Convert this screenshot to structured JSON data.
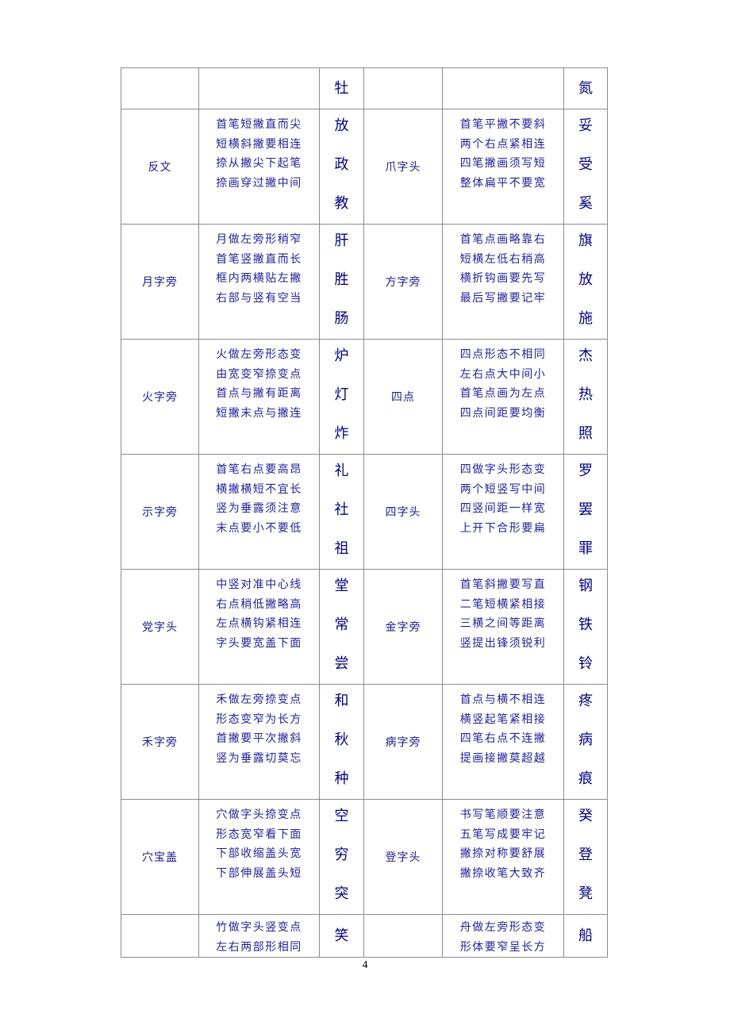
{
  "table": {
    "rows": [
      {
        "left_name": "",
        "left_rhyme": [],
        "left_chars": [
          "牡"
        ],
        "right_name": "",
        "right_rhyme": [],
        "right_chars": [
          "氮"
        ]
      },
      {
        "left_name": "反文",
        "left_rhyme": [
          "首笔短撇直而尖",
          "短横斜撇要相连",
          "捺从撇尖下起笔",
          "捺画穿过撇中间"
        ],
        "left_chars": [
          "放",
          "政",
          "教"
        ],
        "right_name": "爪字头",
        "right_rhyme": [
          "首笔平撇不要斜",
          "两个右点紧相连",
          "四笔撇画须写短",
          "整体扁平不要宽"
        ],
        "right_chars": [
          "妥",
          "受",
          "奚"
        ]
      },
      {
        "left_name": "月字旁",
        "left_rhyme": [
          "月做左旁形稍窄",
          "首笔竖撇直而长",
          "框内两横贴左撇",
          "右部与竖有空当"
        ],
        "left_chars": [
          "肝",
          "胜",
          "肠"
        ],
        "right_name": "方字旁",
        "right_rhyme": [
          "首笔点画略靠右",
          "短横左低右稍高",
          "横折钩画要先写",
          "最后写撇要记牢"
        ],
        "right_chars": [
          "旗",
          "放",
          "施"
        ]
      },
      {
        "left_name": "火字旁",
        "left_rhyme": [
          "火做左旁形态变",
          "由宽变窄捺变点",
          "首点与撇有距离",
          "短撇末点与撇连"
        ],
        "left_chars": [
          "炉",
          "灯",
          "炸"
        ],
        "right_name": "四点",
        "right_rhyme": [
          "四点形态不相同",
          "左右点大中间小",
          "首笔点画为左点",
          "四点间距要均衡"
        ],
        "right_chars": [
          "杰",
          "热",
          "照"
        ]
      },
      {
        "left_name": "示字旁",
        "left_rhyme": [
          "首笔右点要高昂",
          "横撇横短不宜长",
          "竖为垂露须注意",
          "末点要小不要低"
        ],
        "left_chars": [
          "礼",
          "社",
          "祖"
        ],
        "right_name": "四字头",
        "right_rhyme": [
          "四做字头形态变",
          "两个短竖写中间",
          "四竖间距一样宽",
          "上开下合形要扁"
        ],
        "right_chars": [
          "罗",
          "罢",
          "罪"
        ]
      },
      {
        "left_name": "党字头",
        "left_rhyme": [
          "中竖对准中心线",
          "右点稍低撇略高",
          "左点横钩紧相连",
          "字头要宽盖下面"
        ],
        "left_chars": [
          "堂",
          "常",
          "尝"
        ],
        "right_name": "金字旁",
        "right_rhyme": [
          "首笔斜撇要写直",
          "二笔短横紧相接",
          "三横之间等距离",
          "竖提出锋须锐利"
        ],
        "right_chars": [
          "钢",
          "铁",
          "铃"
        ]
      },
      {
        "left_name": "禾字旁",
        "left_rhyme": [
          "禾做左旁捺变点",
          "形态变窄为长方",
          "首撇要平次撇斜",
          "竖为垂露切莫忘"
        ],
        "left_chars": [
          "和",
          "秋",
          "种"
        ],
        "right_name": "病字旁",
        "right_rhyme": [
          "首点与横不相连",
          "横竖起笔紧相接",
          "四笔右点不连撇",
          "提画接撇莫超越"
        ],
        "right_chars": [
          "疼",
          "病",
          "痕"
        ]
      },
      {
        "left_name": "穴宝盖",
        "left_rhyme": [
          "穴做字头捺变点",
          "形态宽窄看下面",
          "下部收缩盖头宽",
          "下部伸展盖头短"
        ],
        "left_chars": [
          "空",
          "穷",
          "突"
        ],
        "right_name": "登字头",
        "right_rhyme": [
          "书写笔顺要注意",
          "五笔写成要牢记",
          "撇捺对称要舒展",
          "撇捺收笔大致齐"
        ],
        "right_chars": [
          "癸",
          "登",
          "凳"
        ]
      },
      {
        "left_name": "",
        "left_rhyme": [
          "竹做字头竖变点",
          "左右两部形相同"
        ],
        "left_chars": [
          "笑"
        ],
        "right_name": "",
        "right_rhyme": [
          "舟做左旁形态变",
          "形体要窄呈长方"
        ],
        "right_chars": [
          "船"
        ]
      }
    ]
  },
  "footer": {
    "page_number": "4"
  }
}
